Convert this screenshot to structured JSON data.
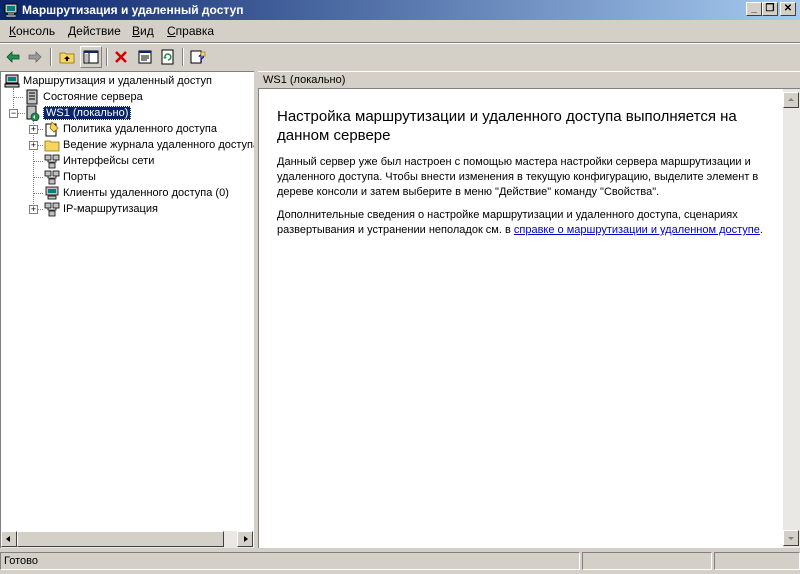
{
  "window": {
    "title": "Маршрутизация и удаленный доступ",
    "minimize_glyph": "_",
    "restore_glyph": "❐",
    "close_glyph": "✕"
  },
  "menu": {
    "items": [
      {
        "underlined": "К",
        "rest": "онсоль"
      },
      {
        "underlined": "Д",
        "rest": "ействие"
      },
      {
        "underlined": "В",
        "rest": "ид"
      },
      {
        "underlined": "С",
        "rest": "правка"
      }
    ]
  },
  "toolbar": {
    "icons": [
      "back-arrow-icon",
      "forward-arrow-icon",
      "up-folder-icon",
      "show-hide-tree-icon",
      "delete-icon",
      "properties-icon",
      "refresh-icon",
      "help-icon"
    ]
  },
  "tree": {
    "root": "Маршрутизация и удаленный доступ",
    "server_status": "Состояние сервера",
    "server": "WS1 (локально)",
    "children": [
      "Политика удаленного доступа",
      "Ведение журнала удаленного доступа",
      "Интерфейсы сети",
      "Порты",
      "Клиенты удаленного доступа (0)",
      "IP-маршрутизация"
    ]
  },
  "right": {
    "header": "WS1 (локально)",
    "heading": "Настройка маршрутизации и удаленного доступа выполняется на данном сервере",
    "paragraph1": "Данный сервер уже был настроен с помощью мастера настройки сервера маршрутизации и удаленного доступа. Чтобы внести изменения в текущую конфигурацию, выделите элемент в дереве консоли и затем выберите в меню \"Действие\" команду \"Свойства\".",
    "paragraph2_prefix": "Дополнительные сведения о настройке маршрутизации и удаленного доступа, сценариях развертывания и устранении неполадок см. в ",
    "paragraph2_link": "справке о маршрутизации и удаленном доступе",
    "paragraph2_suffix": "."
  },
  "status": {
    "text": "Готово"
  },
  "colors": {
    "titlebar_start": "#0a246a",
    "titlebar_end": "#a6caf0",
    "face": "#d4d0c8",
    "selection": "#0a246a",
    "link": "#0000cc"
  }
}
